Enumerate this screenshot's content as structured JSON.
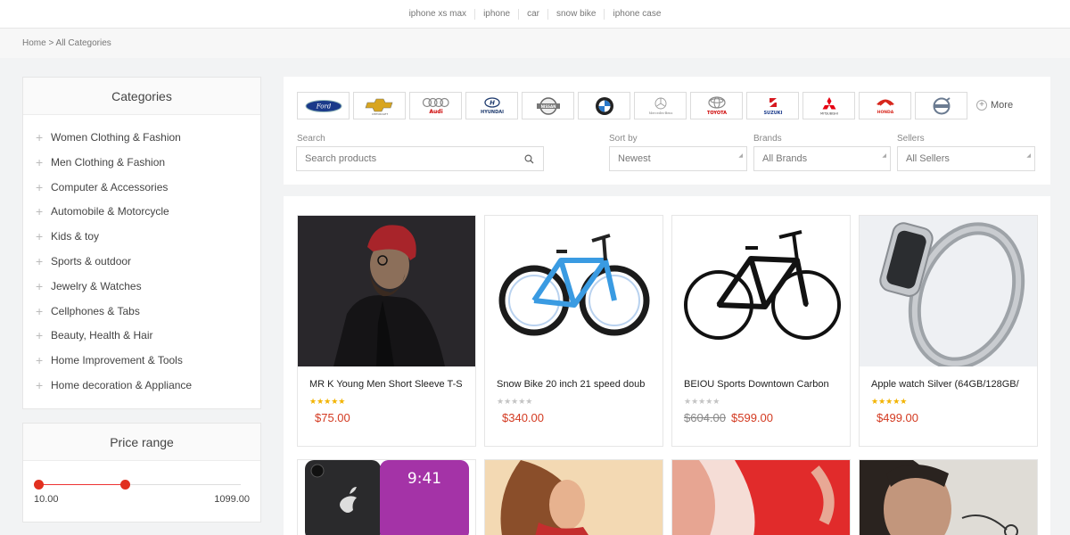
{
  "top_search": {
    "links": [
      "iphone xs max",
      "iphone",
      "car",
      "snow bike",
      "iphone case"
    ]
  },
  "breadcrumb": {
    "text": "Home > All Categories"
  },
  "categories": {
    "title": "Categories",
    "items": [
      "Women Clothing & Fashion",
      "Men Clothing & Fashion",
      "Computer & Accessories",
      "Automobile & Motorcycle",
      "Kids & toy",
      "Sports & outdoor",
      "Jewelry & Watches",
      "Cellphones & Tabs",
      "Beauty, Health & Hair",
      "Home Improvement & Tools",
      "Home decoration & Appliance"
    ]
  },
  "price_range": {
    "title": "Price range",
    "min": "10.00",
    "max": "1099.00"
  },
  "brands": {
    "logos": [
      "ford-logo",
      "chevrolet-logo",
      "audi-logo",
      "hyundai-logo",
      "nissan-logo",
      "bmw-logo",
      "mercedes-logo",
      "toyota-logo",
      "suzuki-logo",
      "mitsubishi-logo",
      "honda-logo",
      "volvo-logo"
    ],
    "more_label": "More"
  },
  "filters": {
    "search_label": "Search",
    "search_placeholder": "Search products",
    "sort_label": "Sort by",
    "sort_value": "Newest",
    "brands_label": "Brands",
    "brands_value": "All Brands",
    "sellers_label": "Sellers",
    "sellers_value": "All Sellers"
  },
  "products": [
    {
      "title": "MR K Young Men Short Sleeve T-S",
      "rating": 5,
      "price": "$75.00",
      "old_price": ""
    },
    {
      "title": "Snow Bike 20 inch 21 speed doub",
      "rating": 0,
      "price": "$340.00",
      "old_price": ""
    },
    {
      "title": "BEIOU Sports Downtown Carbon",
      "rating": 0,
      "price": "$599.00",
      "old_price": "$604.00"
    },
    {
      "title": "Apple watch Silver (64GB/128GB/",
      "rating": 5,
      "price": "$499.00",
      "old_price": ""
    }
  ],
  "colors": {
    "accent": "#d33a21",
    "star": "#f2b300"
  }
}
